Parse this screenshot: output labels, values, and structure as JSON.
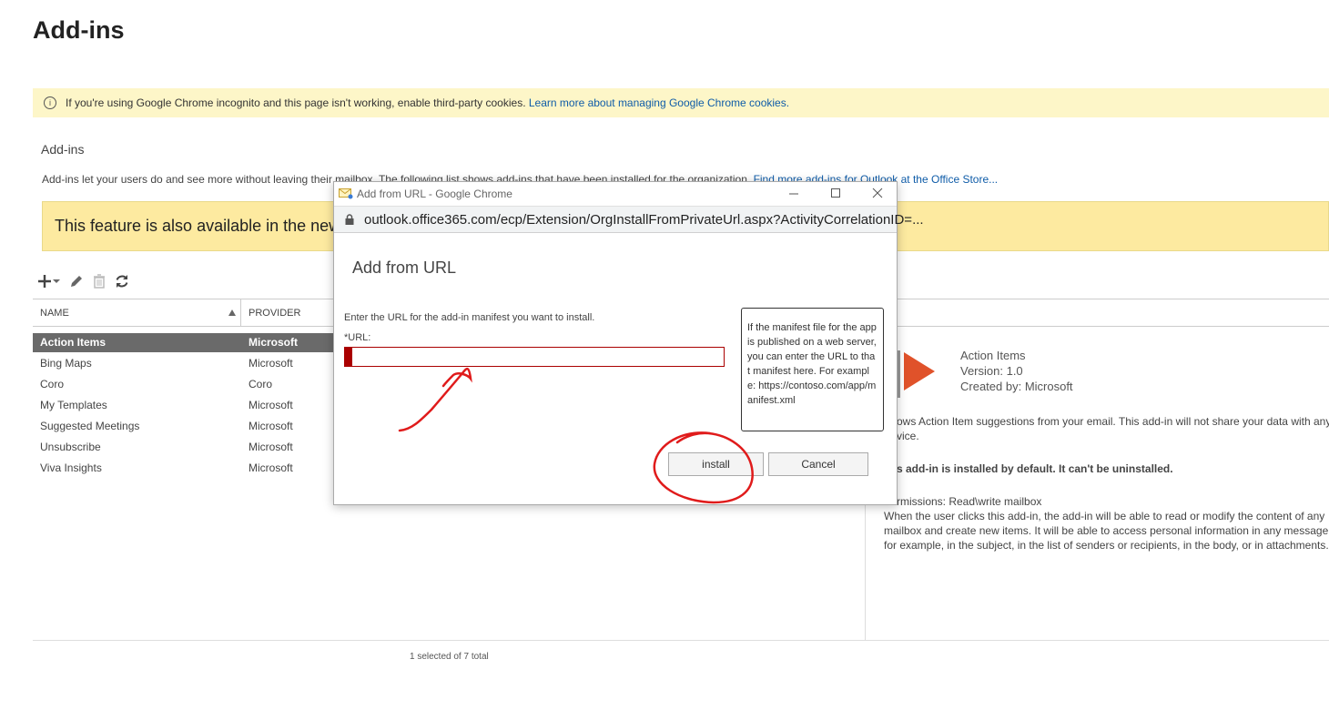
{
  "page": {
    "title": "Add-ins"
  },
  "cookie_banner": {
    "text": "If you're using Google Chrome incognito and this page isn't working, enable third-party cookies.",
    "link": "Learn more about managing Google Chrome cookies."
  },
  "section": {
    "title": "Add-ins",
    "description": "Add-ins let your users do and see more without leaving their mailbox. The following list shows add-ins that have been installed for the organization.",
    "description_link": "Find more add-ins for Outlook at the Office Store..."
  },
  "feature_banner": {
    "text": "This feature is also available in the new"
  },
  "toolbar": {
    "icons": [
      "plus-icon",
      "chevron-down-icon",
      "pencil-icon",
      "trash-icon",
      "refresh-icon"
    ]
  },
  "grid": {
    "columns": [
      "NAME",
      "PROVIDER"
    ],
    "rows": [
      {
        "name": "Action Items",
        "provider": "Microsoft",
        "selected": true
      },
      {
        "name": "Bing Maps",
        "provider": "Microsoft"
      },
      {
        "name": "Coro",
        "provider": "Coro"
      },
      {
        "name": "My Templates",
        "provider": "Microsoft"
      },
      {
        "name": "Suggested Meetings",
        "provider": "Microsoft"
      },
      {
        "name": "Unsubscribe",
        "provider": "Microsoft"
      },
      {
        "name": "Viva Insights",
        "provider": "Microsoft"
      }
    ],
    "status": "1 selected of 7 total"
  },
  "details": {
    "name": "Action Items",
    "version": "Version: 1.0",
    "created_by": "Created by: Microsoft",
    "description_1": "ows Action Item suggestions from your email. This add-in will not share your data with any",
    "description_2": "vice.",
    "default_note": "s add-in is installed by default. It can't be uninstalled.",
    "permissions": "rmissions: Read\\write mailbox",
    "perm_text_1": "When the user clicks this add-in, the add-in will be able to read or modify the content of any",
    "perm_text_2": "mailbox and create new items. It will be able to access personal information in any message o",
    "perm_text_3": "for example, in the subject, in the list of senders or recipients, in the body, or in attachments."
  },
  "popup": {
    "window_title": "Add from URL - Google Chrome",
    "address": "outlook.office365.com/ecp/Extension/OrgInstallFromPrivateUrl.aspx?ActivityCorrelationID=...",
    "dialog_title": "Add from URL",
    "instruction": "Enter the URL for the add-in manifest you want to install.",
    "url_label": "*URL:",
    "url_value": "",
    "tooltip": "If the manifest file for the app is published on a web server, you can enter the URL to that manifest here. For example: https://contoso.com/app/manifest.xml",
    "install_label": "install",
    "cancel_label": "Cancel"
  },
  "colors": {
    "selected_row": "#6a6a6a",
    "cookie_banner": "#fdf6c8",
    "feature_banner": "#fdeaa0",
    "validation_red": "#aa0000",
    "annotation_red": "#e01b1b",
    "accent_orange": "#e0522a"
  }
}
